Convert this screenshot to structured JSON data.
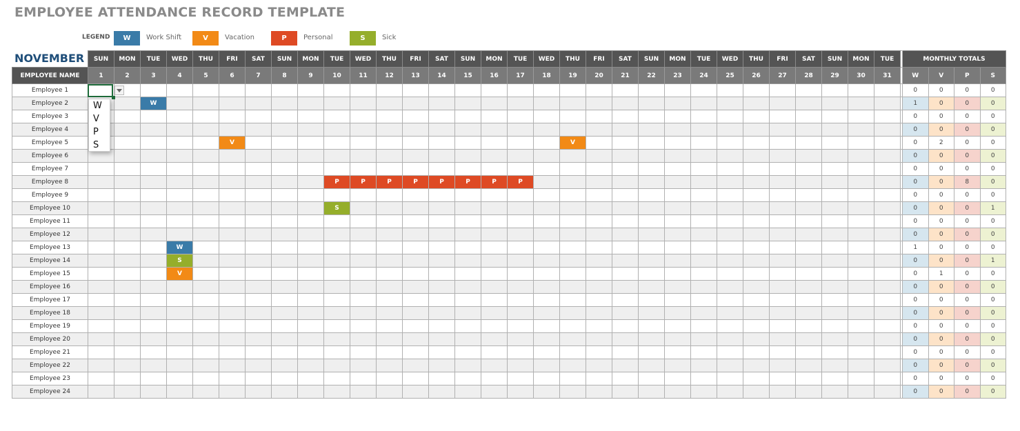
{
  "title": "EMPLOYEE ATTENDANCE RECORD TEMPLATE",
  "legend": {
    "label": "LEGEND",
    "items": [
      {
        "code": "W",
        "text": "Work Shift",
        "color": "#3a7ba8"
      },
      {
        "code": "V",
        "text": "Vacation",
        "color": "#f28a16"
      },
      {
        "code": "P",
        "text": "Personal",
        "color": "#de4a24"
      },
      {
        "code": "S",
        "text": "Sick",
        "color": "#95ae2b"
      }
    ]
  },
  "month": "NOVEMBER",
  "name_header": "EMPLOYEE NAME",
  "totals_header": "MONTHLY TOTALS",
  "totals_columns": [
    "W",
    "V",
    "P",
    "S"
  ],
  "day_names": [
    "SUN",
    "MON",
    "TUE",
    "WED",
    "THU",
    "FRI",
    "SAT",
    "SUN",
    "MON",
    "TUE",
    "WED",
    "THU",
    "FRI",
    "SAT",
    "SUN",
    "MON",
    "TUE",
    "WED",
    "THU",
    "FRI",
    "SAT",
    "SUN",
    "MON",
    "TUE",
    "WED",
    "THU",
    "FRI",
    "SAT",
    "SUN",
    "MON",
    "TUE"
  ],
  "day_numbers": [
    "1",
    "2",
    "3",
    "4",
    "5",
    "6",
    "7",
    "8",
    "9",
    "10",
    "11",
    "12",
    "13",
    "14",
    "15",
    "16",
    "17",
    "18",
    "19",
    "20",
    "21",
    "22",
    "23",
    "24",
    "25",
    "26",
    "27",
    "28",
    "29",
    "30",
    "31"
  ],
  "employees": [
    {
      "name": "Employee 1",
      "marks": {},
      "totals": [
        "0",
        "0",
        "0",
        "0"
      ]
    },
    {
      "name": "Employee 2",
      "marks": {
        "3": "W"
      },
      "totals": [
        "1",
        "0",
        "0",
        "0"
      ]
    },
    {
      "name": "Employee 3",
      "marks": {},
      "totals": [
        "0",
        "0",
        "0",
        "0"
      ]
    },
    {
      "name": "Employee 4",
      "marks": {},
      "totals": [
        "0",
        "0",
        "0",
        "0"
      ]
    },
    {
      "name": "Employee 5",
      "marks": {
        "6": "V",
        "19": "V"
      },
      "totals": [
        "0",
        "2",
        "0",
        "0"
      ]
    },
    {
      "name": "Employee 6",
      "marks": {},
      "totals": [
        "0",
        "0",
        "0",
        "0"
      ]
    },
    {
      "name": "Employee 7",
      "marks": {},
      "totals": [
        "0",
        "0",
        "0",
        "0"
      ]
    },
    {
      "name": "Employee 8",
      "marks": {
        "10": "P",
        "11": "P",
        "12": "P",
        "13": "P",
        "14": "P",
        "15": "P",
        "16": "P",
        "17": "P"
      },
      "totals": [
        "0",
        "0",
        "8",
        "0"
      ]
    },
    {
      "name": "Employee 9",
      "marks": {},
      "totals": [
        "0",
        "0",
        "0",
        "0"
      ]
    },
    {
      "name": "Employee 10",
      "marks": {
        "10": "S"
      },
      "totals": [
        "0",
        "0",
        "0",
        "1"
      ]
    },
    {
      "name": "Employee 11",
      "marks": {},
      "totals": [
        "0",
        "0",
        "0",
        "0"
      ]
    },
    {
      "name": "Employee 12",
      "marks": {},
      "totals": [
        "0",
        "0",
        "0",
        "0"
      ]
    },
    {
      "name": "Employee 13",
      "marks": {
        "4": "W"
      },
      "totals": [
        "1",
        "0",
        "0",
        "0"
      ]
    },
    {
      "name": "Employee 14",
      "marks": {
        "4": "S"
      },
      "totals": [
        "0",
        "0",
        "0",
        "1"
      ]
    },
    {
      "name": "Employee 15",
      "marks": {
        "4": "V"
      },
      "totals": [
        "0",
        "1",
        "0",
        "0"
      ]
    },
    {
      "name": "Employee 16",
      "marks": {},
      "totals": [
        "0",
        "0",
        "0",
        "0"
      ]
    },
    {
      "name": "Employee 17",
      "marks": {},
      "totals": [
        "0",
        "0",
        "0",
        "0"
      ]
    },
    {
      "name": "Employee 18",
      "marks": {},
      "totals": [
        "0",
        "0",
        "0",
        "0"
      ]
    },
    {
      "name": "Employee 19",
      "marks": {},
      "totals": [
        "0",
        "0",
        "0",
        "0"
      ]
    },
    {
      "name": "Employee 20",
      "marks": {},
      "totals": [
        "0",
        "0",
        "0",
        "0"
      ]
    },
    {
      "name": "Employee 21",
      "marks": {},
      "totals": [
        "0",
        "0",
        "0",
        "0"
      ]
    },
    {
      "name": "Employee 22",
      "marks": {},
      "totals": [
        "0",
        "0",
        "0",
        "0"
      ]
    },
    {
      "name": "Employee 23",
      "marks": {},
      "totals": [
        "0",
        "0",
        "0",
        "0"
      ]
    },
    {
      "name": "Employee 24",
      "marks": {},
      "totals": [
        "0",
        "0",
        "0",
        "0"
      ]
    }
  ],
  "dropdown": {
    "options": [
      "W",
      "V",
      "P",
      "S"
    ]
  }
}
